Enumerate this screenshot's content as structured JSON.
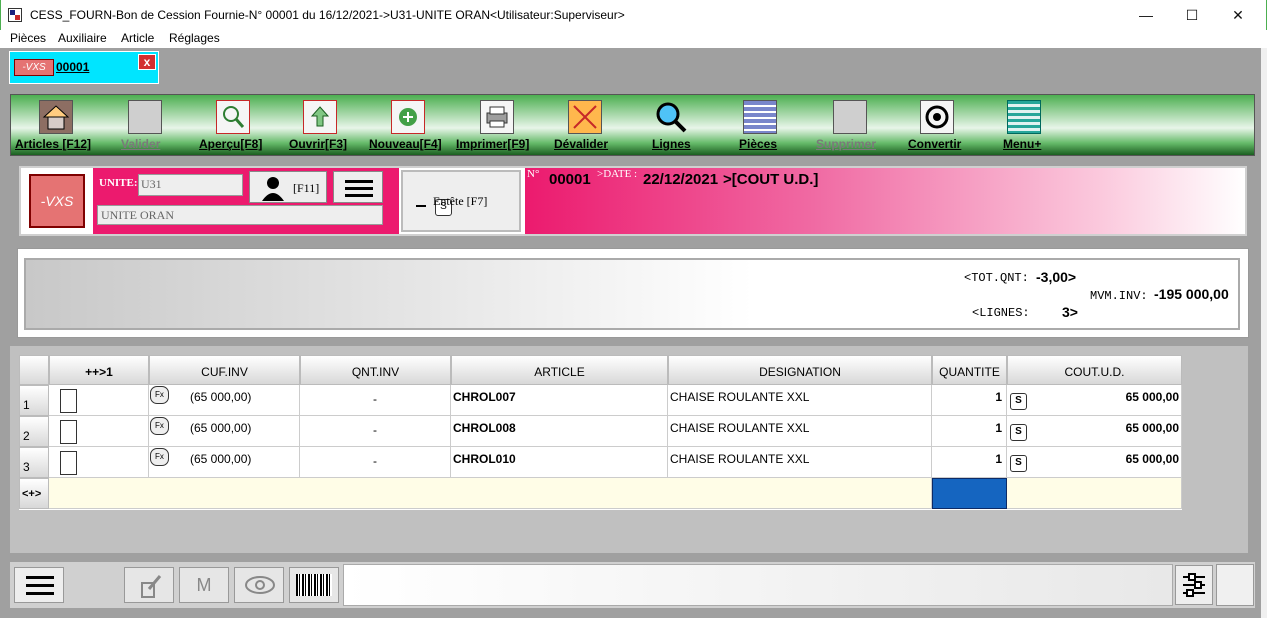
{
  "window": {
    "title": "CESS_FOURN-Bon de Cession Fournie-N° 00001 du 16/12/2021->U31-UNITE ORAN<Utilisateur:Superviseur>",
    "minimize": "—",
    "maximize": "☐",
    "close": "✕"
  },
  "menu": [
    "Pièces",
    "Auxiliaire",
    "Article",
    "Réglages"
  ],
  "doc_tab": {
    "logo": "-VXS",
    "number": "00001",
    "close": "x"
  },
  "toolbar": [
    {
      "label": "Articles [F12]",
      "icon": "house-icon",
      "enabled": true
    },
    {
      "label": "Valider",
      "icon": "check-box-icon",
      "enabled": false
    },
    {
      "label": "Aperçu[F8]",
      "icon": "preview-icon",
      "enabled": true
    },
    {
      "label": "Ouvrir[F3]",
      "icon": "open-icon",
      "enabled": true
    },
    {
      "label": "Nouveau[F4]",
      "icon": "new-icon",
      "enabled": true
    },
    {
      "label": "Imprimer[F9]",
      "icon": "printer-icon",
      "enabled": true
    },
    {
      "label": "Dévalider",
      "icon": "unvalidate-icon",
      "enabled": true
    },
    {
      "label": "Lignes",
      "icon": "magnifier-icon",
      "enabled": true
    },
    {
      "label": "Pièces",
      "icon": "documents-icon",
      "enabled": true
    },
    {
      "label": "Supprimer",
      "icon": "trash-icon",
      "enabled": false
    },
    {
      "label": "Convertir",
      "icon": "convert-icon",
      "enabled": true
    },
    {
      "label": "Menu+",
      "icon": "menu-lines-icon",
      "enabled": true
    }
  ],
  "header": {
    "logo": "-VXS",
    "unite_label": "UNITE:",
    "unite_code": "U31",
    "unite_name": "UNITE ORAN",
    "user_shortcut": "[F11]",
    "entete_mark": "S",
    "entete_label": "Entête [F7]",
    "num_label": "N°",
    "num_value": "00001",
    "date_label": ">DATE :",
    "date_value": "22/12/2021",
    "cost_value": ">[COUT U.D.]"
  },
  "totals": {
    "tot_qnt_label": "<TOT.QNT:",
    "tot_qnt_value": "-3,00>",
    "lignes_label": "<LIGNES:",
    "lignes_value": "3>",
    "mvm_inv_label": "MVM.INV:",
    "mvm_inv_value": "-195 000,00"
  },
  "table": {
    "columns": [
      "",
      "++>1",
      "CUF.INV",
      "QNT.INV",
      "ARTICLE",
      "DESIGNATION",
      "QUANTITE",
      "COUT.U.D."
    ],
    "rows": [
      {
        "num": "1",
        "cuf": "(65 000,00)",
        "qnt_inv": "-",
        "article": "CHROL007",
        "designation": "CHAISE ROULANTE XXL",
        "quantite": "1",
        "cout": "65 000,00"
      },
      {
        "num": "2",
        "cuf": "(65 000,00)",
        "qnt_inv": "-",
        "article": "CHROL008",
        "designation": "CHAISE ROULANTE XXL",
        "quantite": "1",
        "cout": "65 000,00"
      },
      {
        "num": "3",
        "cuf": "(65 000,00)",
        "qnt_inv": "-",
        "article": "CHROL010",
        "designation": "CHAISE ROULANTE XXL",
        "quantite": "1",
        "cout": "65 000,00"
      }
    ],
    "new_row_marker": "<+>",
    "fx_label": "Fx",
    "s_label": "S"
  },
  "bottom": {
    "m_label": "M"
  }
}
